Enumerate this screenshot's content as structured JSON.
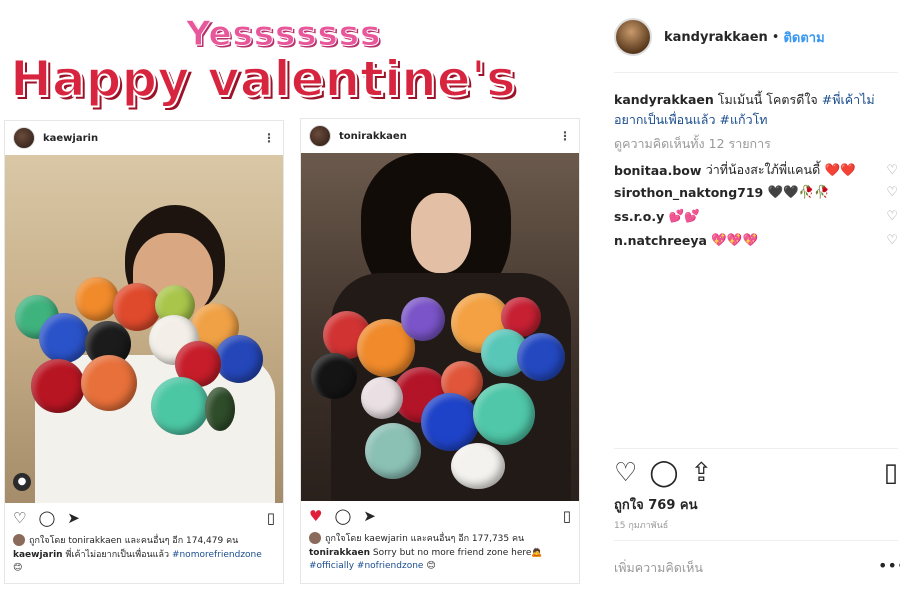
{
  "overlay": {
    "title_top": "Yesssssss",
    "title_main": "Happy valentine's"
  },
  "left_post": {
    "username": "kaewjarin",
    "liked_by": "ถูกใจโดย tonirakkaen และคนอื่นๆ อีก 174,479 คน",
    "caption_user": "kaewjarin",
    "caption_text": "พี่เค้าไม่อยากเป็นเพื่อนแล้ว",
    "caption_tag": "#nomorefriendzone",
    "caption_emoji": "😊"
  },
  "right_post": {
    "username": "tonirakkaen",
    "liked_by": "ถูกใจโดย kaewjarin และคนอื่นๆ อีก 177,735 คน",
    "caption_user": "tonirakkaen",
    "caption_text": "Sorry but no more friend zone here🙇",
    "caption_tags": "#officially #nofriendzone",
    "caption_emoji": "😊"
  },
  "panel": {
    "username": "kandyrakkaen",
    "dot": "•",
    "follow_label": "ติดตาม",
    "caption_user": "kandyrakkaen",
    "caption_text": "โมเม้นนี้ โคตรดีใจ",
    "caption_tag1": "#พี่เค้าไม่อยากเป็นเพื่อนแล้ว",
    "caption_tag2": "#แก้วโท",
    "view_all": "ดูความคิดเห็นทั้ง 12 รายการ",
    "comments": [
      {
        "user": "bonitaa.bow",
        "text": "ว่าที่น้องสะใภ้พี่แคนดี้",
        "emoji": "❤️❤️"
      },
      {
        "user": "sirothon_naktong719",
        "text": "",
        "emoji": "🖤🖤🥀🥀"
      },
      {
        "user": "ss.r.o.y",
        "text": "",
        "emoji": "💕💕"
      },
      {
        "user": "n.natchreeya",
        "text": "",
        "emoji": "💖💖💖"
      }
    ],
    "likes": "ถูกใจ 769 คน",
    "date": "15 กุมภาพันธ์",
    "add_comment_placeholder": "เพิ่มความคิดเห็น",
    "more": "•••"
  },
  "colors": {
    "link": "#3897f0",
    "hashtag": "#1a4d8e",
    "title_pink": "#e8579a",
    "title_red": "#d8253f"
  }
}
